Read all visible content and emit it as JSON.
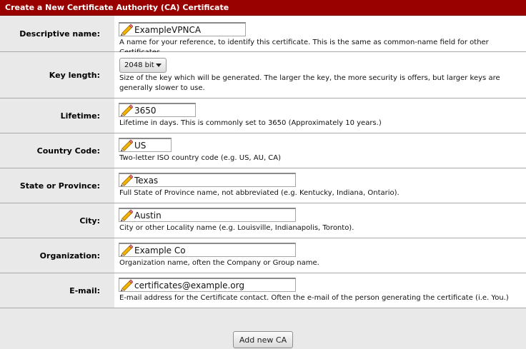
{
  "header": {
    "title": "Create a New Certificate Authority (CA) Certificate"
  },
  "fields": {
    "descriptive_name": {
      "label": "Descriptive name:",
      "value": "ExampleVPNCA",
      "help": "A name for your reference, to identify this certificate. This is the same as common-name field for other Certificates."
    },
    "key_length": {
      "label": "Key length:",
      "selected": "2048 bit",
      "help": "Size of the key which will be generated. The larger the key, the more security is offers, but larger keys are generally slower to use."
    },
    "lifetime": {
      "label": "Lifetime:",
      "value": "3650",
      "help": "Lifetime in days. This is commonly set to 3650 (Approximately 10 years.)"
    },
    "country_code": {
      "label": "Country Code:",
      "value": "US",
      "help": "Two-letter ISO country code (e.g. US, AU, CA)"
    },
    "state": {
      "label": "State or Province:",
      "value": "Texas",
      "help": "Full State of Province name, not abbreviated (e.g. Kentucky, Indiana, Ontario)."
    },
    "city": {
      "label": "City:",
      "value": "Austin",
      "help": "City or other Locality name (e.g. Louisville, Indianapolis, Toronto)."
    },
    "organization": {
      "label": "Organization:",
      "value": "Example Co",
      "help": "Organization name, often the Company or Group name."
    },
    "email": {
      "label": "E-mail:",
      "value": "certificates@example.org",
      "help": "E-mail address for the Certificate contact. Often the e-mail of the person generating the certificate (i.e. You.)"
    }
  },
  "actions": {
    "submit_label": "Add new CA"
  },
  "colors": {
    "header_bg": "#990000",
    "label_bg": "#e9e9e9",
    "cell_bg": "#ffffff"
  },
  "icons": {
    "field_icon": "pencil-icon"
  }
}
